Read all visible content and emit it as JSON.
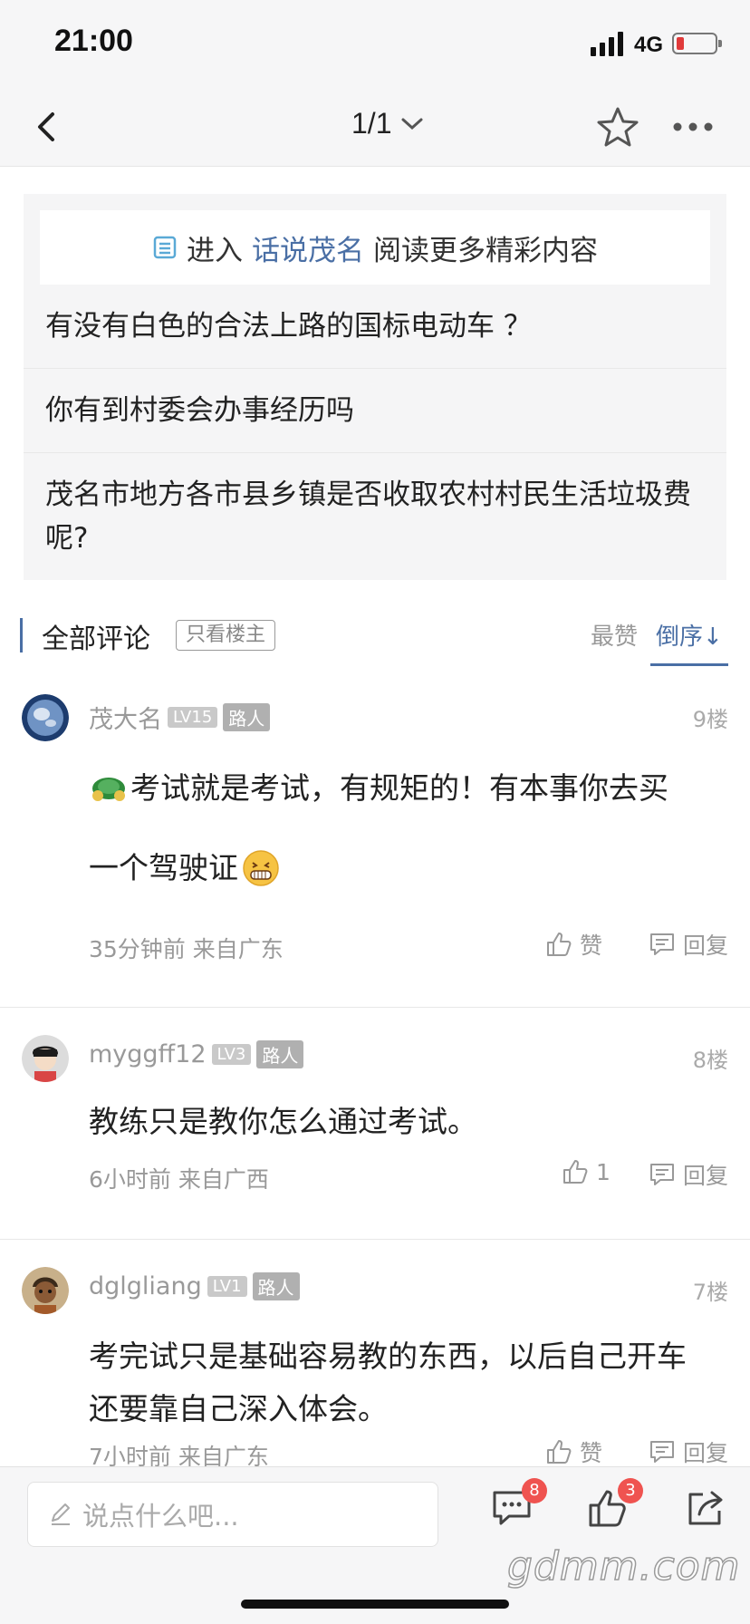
{
  "status_bar": {
    "time": "21:00",
    "network": "4G"
  },
  "nav": {
    "page_indicator": "1/1"
  },
  "related": {
    "enter_prefix": "进入",
    "forum_name": "话说茂名",
    "enter_suffix": "阅读更多精彩内容",
    "items": [
      "有没有白色的合法上路的国标电动车 ？",
      "你有到村委会办事经历吗",
      "茂名市地方各市县乡镇是否收取农村村民生活垃圾费呢?"
    ]
  },
  "comments_header": {
    "title": "全部评论",
    "only_op": "只看楼主",
    "sort_hot": "最赞",
    "sort_desc": "倒序↓"
  },
  "comments": [
    {
      "user": "茂大名",
      "level": "LV15",
      "role": "路人",
      "floor": "9楼",
      "line1": "考试就是考试，有规矩的！有本事你去买",
      "line2": "一个驾驶证",
      "meta": "35分钟前 来自广东",
      "like": "赞",
      "reply": "回复"
    },
    {
      "user": "myggff12",
      "level": "LV3",
      "role": "路人",
      "floor": "8楼",
      "text": "教练只是教你怎么通过考试。",
      "meta": "6小时前 来自广西",
      "like": "1",
      "reply": "回复"
    },
    {
      "user": "dglgliang",
      "level": "LV1",
      "role": "路人",
      "floor": "7楼",
      "text": "考完试只是基础容易教的东西，以后自己开车还要靠自己深入体会。",
      "meta": "7小时前 来自广东",
      "like": "赞",
      "reply": "回复"
    }
  ],
  "bottom_bar": {
    "input_placeholder": "说点什么吧...",
    "comment_count": "8",
    "like_count": "3",
    "watermark": "gdmm.com"
  },
  "colors": {
    "accent": "#4a6fa5",
    "badge": "#ef5350",
    "battery_low": "#e03a3a"
  }
}
